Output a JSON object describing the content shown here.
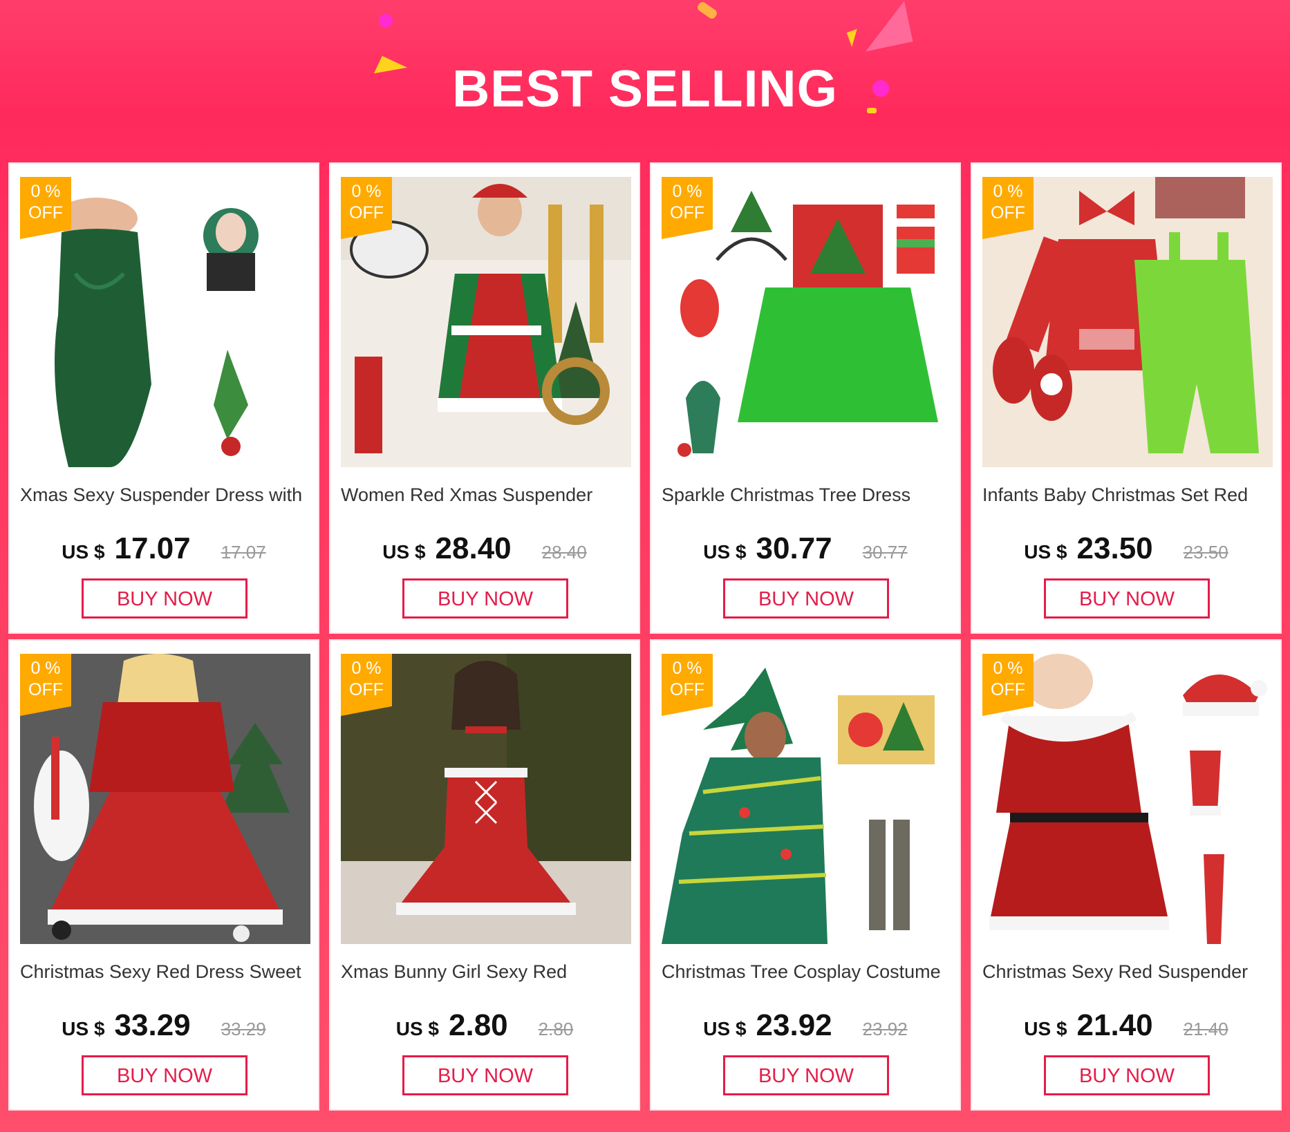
{
  "banner": {
    "title": "BEST SELLING",
    "background": "#ff2a5c"
  },
  "colors": {
    "accent": "#e41c49",
    "badge": "#ffaa00"
  },
  "products": [
    {
      "name": "Xmas Sexy Suspender Dress with",
      "currency": "US $",
      "price": "17.07",
      "old_price": "17.07",
      "badge_pct": "0 %",
      "badge_off": "OFF",
      "buy": "BUY NOW",
      "image": "green-sequin-dress-set"
    },
    {
      "name": "Women Red Xmas Suspender",
      "currency": "US $",
      "price": "28.40",
      "old_price": "28.40",
      "badge_pct": "0 %",
      "badge_off": "OFF",
      "buy": "BUY NOW",
      "image": "red-green-santa-dress"
    },
    {
      "name": "Sparkle Christmas Tree Dress",
      "currency": "US $",
      "price": "30.77",
      "old_price": "30.77",
      "badge_pct": "0 %",
      "badge_off": "OFF",
      "buy": "BUY NOW",
      "image": "green-tutu-tree-dress"
    },
    {
      "name": "Infants Baby Christmas Set Red",
      "currency": "US $",
      "price": "23.50",
      "old_price": "23.50",
      "badge_pct": "0 %",
      "badge_off": "OFF",
      "buy": "BUY NOW",
      "image": "baby-christmas-set"
    },
    {
      "name": "Christmas Sexy Red Dress Sweet",
      "currency": "US $",
      "price": "33.29",
      "old_price": "33.29",
      "badge_pct": "0 %",
      "badge_off": "OFF",
      "buy": "BUY NOW",
      "image": "red-velvet-cape-dress"
    },
    {
      "name": "Xmas Bunny Girl Sexy Red",
      "currency": "US $",
      "price": "2.80",
      "old_price": "2.80",
      "badge_pct": "0 %",
      "badge_off": "OFF",
      "buy": "BUY NOW",
      "image": "red-lace-up-dress"
    },
    {
      "name": "Christmas Tree Cosplay Costume",
      "currency": "US $",
      "price": "23.92",
      "old_price": "23.92",
      "badge_pct": "0 %",
      "badge_off": "OFF",
      "buy": "BUY NOW",
      "image": "tree-cape-costume"
    },
    {
      "name": "Christmas Sexy Red Suspender",
      "currency": "US $",
      "price": "21.40",
      "old_price": "21.40",
      "badge_pct": "0 %",
      "badge_off": "OFF",
      "buy": "BUY NOW",
      "image": "red-santa-dress-set"
    }
  ]
}
